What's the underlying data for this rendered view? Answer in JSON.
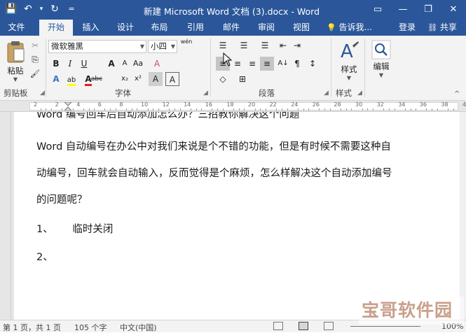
{
  "window": {
    "title": "新建 Microsoft Word 文档 (3).docx - Word",
    "controls": {
      "options": "▭",
      "minimize": "—",
      "restore": "❐",
      "close": "✕"
    }
  },
  "qat": {
    "save": "💾",
    "undo": "↶",
    "undo_more": "▾",
    "redo": "↻",
    "customize": "="
  },
  "tabs": [
    {
      "label": "文件"
    },
    {
      "label": "开始"
    },
    {
      "label": "插入"
    },
    {
      "label": "设计"
    },
    {
      "label": "布局"
    },
    {
      "label": "引用"
    },
    {
      "label": "邮件"
    },
    {
      "label": "审阅"
    },
    {
      "label": "视图"
    }
  ],
  "tell_me": {
    "icon": "💡",
    "text": "告诉我..."
  },
  "account": {
    "login": "登录",
    "share_icon": "⛓",
    "share": "共享"
  },
  "ribbon": {
    "clipboard": {
      "paste": "粘贴",
      "cut": "✂",
      "copy": "⎘",
      "format_painter": "🖌",
      "label": "剪贴板"
    },
    "font": {
      "name": "微软雅黑",
      "size": "小四",
      "pinyin": "wén",
      "grow": "A",
      "shrink": "A",
      "case": "Aa",
      "clear": "A",
      "bold": "B",
      "italic": "I",
      "underline": "U",
      "strike": "abc",
      "sub": "x₂",
      "sup": "x²",
      "effects": "A",
      "highlight": "ab",
      "color": "A",
      "shade": "A",
      "border": "A",
      "label": "字体"
    },
    "paragraph": {
      "bullets": "☰",
      "numbering": "☰",
      "multilevel": "☰",
      "decrease": "⇤",
      "increase": "⇥",
      "sort": "A↓",
      "marks": "¶",
      "left": "≡",
      "center": "≡",
      "right": "≡",
      "justify": "≡",
      "distributed": "≡",
      "spacing": "↕",
      "shading": "◇",
      "borders": "⊞",
      "label": "段落"
    },
    "styles": {
      "btn": "样式",
      "label": "样式"
    },
    "editing": {
      "btn": "编辑"
    }
  },
  "ruler": {
    "numbers": [
      "2",
      "2",
      "4",
      "6",
      "8",
      "10",
      "12",
      "14",
      "16",
      "18",
      "20",
      "22",
      "24",
      "26",
      "28",
      "30",
      "32",
      "34",
      "36",
      "38",
      "40"
    ]
  },
  "document": {
    "lines": [
      "Word 编号回车后自动添加怎么办？三招教你解决这个问题",
      "Word 自动编号在办公中对我们来说是个不错的功能，但是有时候不需要这种自",
      "动编号，回车就会自动输入，反而觉得是个麻烦，怎么样解决这个自动添加编号",
      "的问题呢？",
      "1、      临时关闭",
      "2、"
    ]
  },
  "status": {
    "page": "第 1 页，共 1 页",
    "words": "105 个字",
    "language": "中文(中国)",
    "zoom": "100%"
  },
  "watermark": "宝哥软件园",
  "colors": {
    "brand": "#2b579a",
    "ribbon_bg": "#f3f3f3",
    "highlight": "#ffff00",
    "font_color": "#e02020"
  }
}
